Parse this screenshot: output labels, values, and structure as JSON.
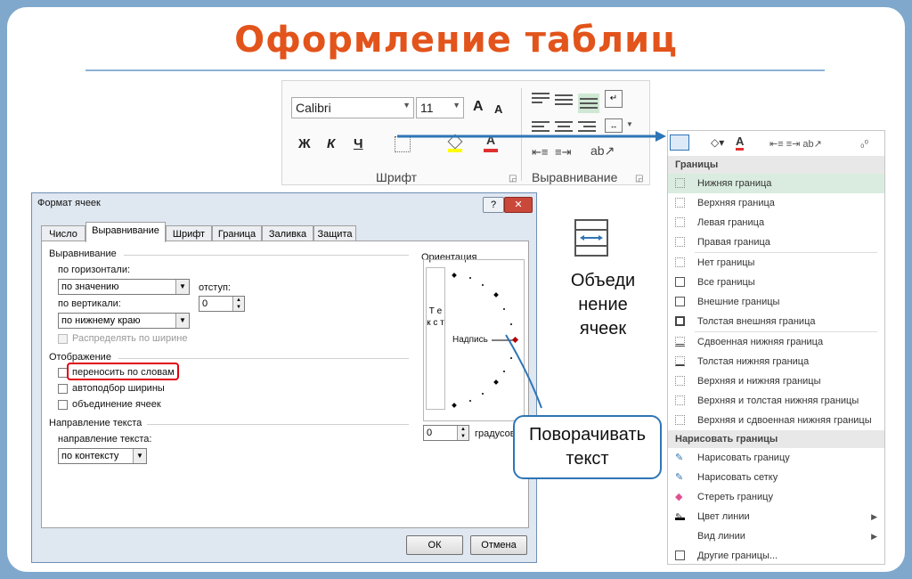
{
  "slide": {
    "title": "Оформление таблиц"
  },
  "ribbon": {
    "font_name": "Calibri",
    "font_size": "11",
    "grow_font": "A",
    "shrink_font": "A",
    "bold": "Ж",
    "italic": "К",
    "underline": "Ч",
    "font_group": "Шрифт",
    "align_group": "Выравнивание"
  },
  "dialog": {
    "title": "Формат ячеек",
    "help": "?",
    "close": "✕",
    "tabs": [
      "Число",
      "Выравнивание",
      "Шрифт",
      "Граница",
      "Заливка",
      "Защита"
    ],
    "align_section": "Выравнивание",
    "horizontal_label": "по горизонтали:",
    "horizontal_value": "по значению",
    "indent_label": "отступ:",
    "indent_value": "0",
    "vertical_label": "по вертикали:",
    "vertical_value": "по нижнему краю",
    "distribute": "Распределять по ширине",
    "display_section": "Отображение",
    "wrap_text": "переносить по словам",
    "autofit": "автоподбор ширины",
    "merge": "объединение ячеек",
    "direction_section": "Направление текста",
    "direction_label": "направление текста:",
    "direction_value": "по контексту",
    "orientation_section": "Ориентация",
    "vertical_text": "Т е к с т",
    "inscription": "Надпись",
    "degrees_value": "0",
    "degrees_label": "градусов",
    "ok": "ОК",
    "cancel": "Отмена"
  },
  "merge_caption": "Объеди нение ячеек",
  "callout": "Поворачивать текст",
  "borders_menu": {
    "header": "Границы",
    "items": [
      "Нижняя граница",
      "Верхняя граница",
      "Левая граница",
      "Правая граница",
      "Нет границы",
      "Все границы",
      "Внешние границы",
      "Толстая внешняя граница",
      "Сдвоенная нижняя граница",
      "Толстая нижняя граница",
      "Верхняя и нижняя границы",
      "Верхняя и толстая нижняя границы",
      "Верхняя и сдвоенная нижняя границы"
    ],
    "draw_header": "Нарисовать границы",
    "draw_items": [
      "Нарисовать границу",
      "Нарисовать сетку",
      "Стереть границу",
      "Цвет линии",
      "Вид линии",
      "Другие границы..."
    ]
  },
  "colors": {
    "title": "#e2541b",
    "highlight": "#e3000f",
    "accent": "#2e75b6"
  }
}
